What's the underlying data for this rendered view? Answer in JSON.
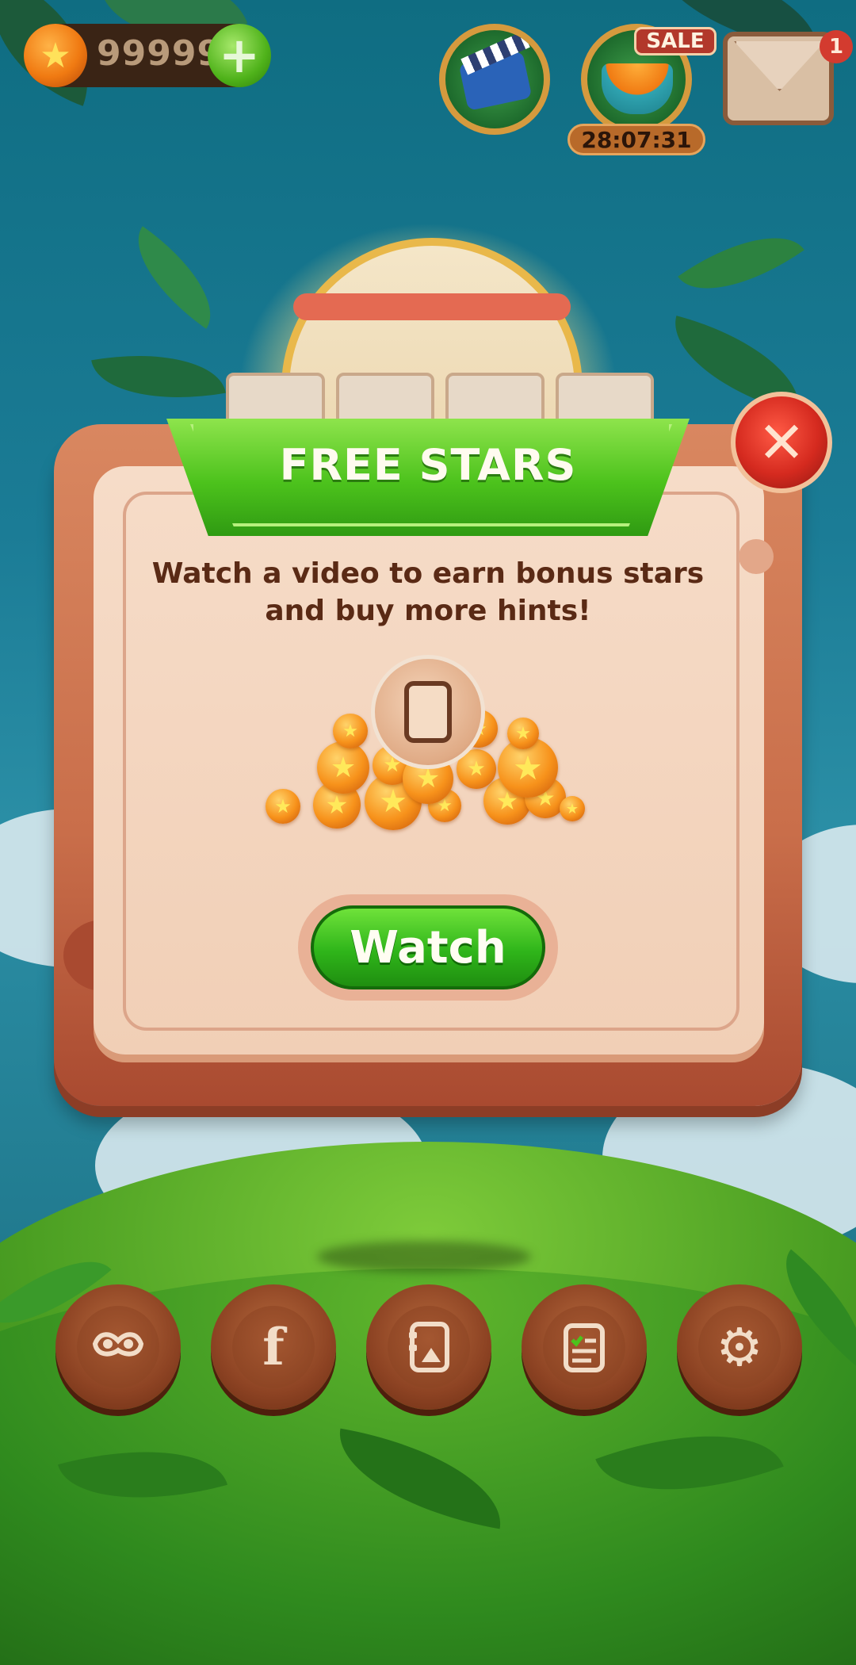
{
  "hud": {
    "stars_count": "99999",
    "sale_label": "SALE",
    "sale_timer": "28:07:31",
    "mail_badge_count": "1"
  },
  "popup": {
    "title": "FREE STARS",
    "description": "Watch a video to earn bonus stars and buy more hints!",
    "watch_label": "Watch"
  },
  "icons": {
    "close": "close-icon",
    "plus": "plus-icon",
    "nav": [
      "mask-icon",
      "facebook-icon",
      "gallery-book-icon",
      "tasks-clipboard-icon",
      "gear-icon"
    ]
  },
  "colors": {
    "primary_green": "#2fb51a",
    "popup_brown": "#c96e4a",
    "close_red": "#d52a1f",
    "text_brown": "#5a2a15"
  }
}
